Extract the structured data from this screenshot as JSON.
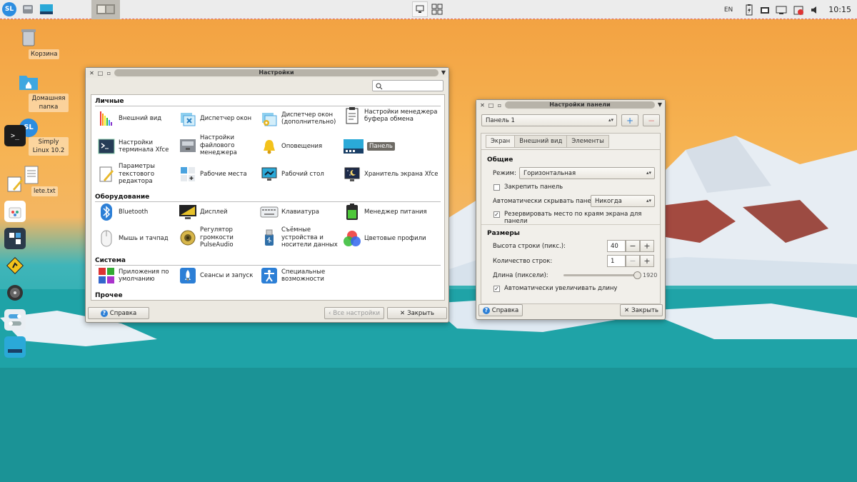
{
  "top_panel": {
    "language": "EN",
    "clock": "10:15"
  },
  "desktop": {
    "icons": [
      {
        "label": "Корзина"
      },
      {
        "label": "Домашняя папка"
      },
      {
        "label": "Simply Linux 10.2"
      },
      {
        "label": "lete.txt"
      }
    ]
  },
  "settings_window": {
    "title": "Настройки",
    "search": {
      "placeholder": ""
    },
    "sections": {
      "personal": "Личные",
      "hardware": "Оборудование",
      "system": "Система",
      "other": "Прочее"
    },
    "items": {
      "appearance": "Внешний вид",
      "window_manager": "Диспетчер окон",
      "window_manager_adv": "Диспетчер окон (дополнительно)",
      "clipboard": "Настройки менеджера буфера обмена",
      "terminal": "Настройки терминала Xfce",
      "file_manager": "Настройки файлового менеджера",
      "notifications": "Оповещения",
      "panel": "Панель",
      "text_editor": "Параметры текстового редактора",
      "workspaces": "Рабочие места",
      "desktop": "Рабочий стол",
      "screensaver": "Хранитель экрана Xfce",
      "bluetooth": "Bluetooth",
      "display": "Дисплей",
      "keyboard": "Клавиатура",
      "power": "Менеджер питания",
      "mouse": "Мышь и тачпад",
      "volume": "Регулятор громкости PulseAudio",
      "removable": "Съёмные устройства и носители данных",
      "color": "Цветовые профили",
      "default_apps": "Приложения по умолчанию",
      "sessions": "Сеансы и запуск",
      "accessibility": "Специальные возможности"
    },
    "buttons": {
      "help": "Справка",
      "all_settings": "Все настройки",
      "close": "Закрыть"
    }
  },
  "panel_window": {
    "title": "Настройки панели",
    "panel_select": "Панель 1",
    "tabs": [
      "Экран",
      "Внешний вид",
      "Элементы"
    ],
    "general": {
      "heading": "Общие",
      "mode_label": "Режим:",
      "mode_value": "Горизонтальная",
      "lock_panel": "Закрепить панель",
      "lock_checked": false,
      "autohide_label": "Автоматически скрывать панель:",
      "autohide_value": "Никогда",
      "reserve_space": "Резервировать место по краям экрана для панели",
      "reserve_checked": true
    },
    "sizes": {
      "heading": "Размеры",
      "row_height_label": "Высота строки (пикс.):",
      "row_height_value": "40",
      "rows_label": "Количество строк:",
      "rows_value": "1",
      "length_label": "Длина (пиксели):",
      "length_value": "1920",
      "length_fraction": 1.0,
      "auto_length": "Автоматически увеличивать длину",
      "auto_length_checked": true
    },
    "buttons": {
      "help": "Справка",
      "close": "Закрыть"
    }
  },
  "colors": {
    "accent": "#2c8de0",
    "selection": "#6d6a64"
  }
}
